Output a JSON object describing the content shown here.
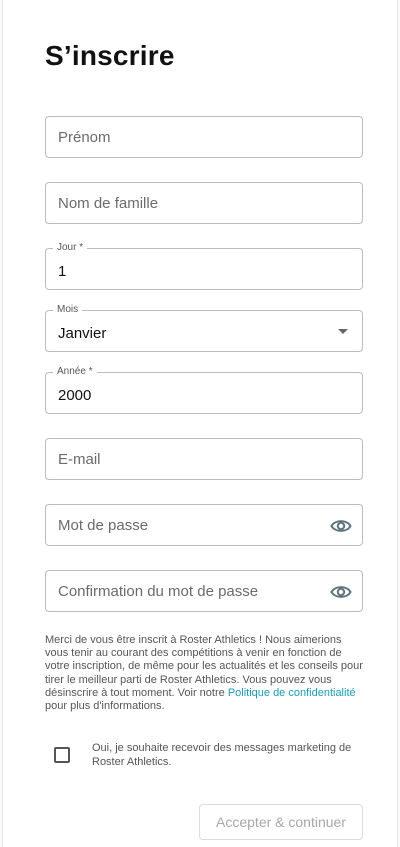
{
  "form": {
    "title": "S’inscrire",
    "first_name": {
      "placeholder": "Prénom"
    },
    "last_name": {
      "placeholder": "Nom de famille"
    },
    "day": {
      "label": "Jour *",
      "value": "1"
    },
    "month": {
      "label": "Mois",
      "value": "Janvier"
    },
    "year": {
      "label": "Année *",
      "value": "2000"
    },
    "email": {
      "placeholder": "E-mail"
    },
    "password": {
      "placeholder": "Mot de passe"
    },
    "password_confirm": {
      "placeholder": "Confirmation du mot de passe"
    },
    "notice": {
      "text": "Merci de vous être inscrit à Roster Athletics ! Nous aimerions vous tenir au courant des compétitions à venir en fonction de votre inscription, de même pour les actualités et les conseils pour tirer le meilleur parti de Roster Athletics. Vous pouvez vous désinscrire à tout moment. Voir notre ",
      "link": "Politique de confidentialité",
      "suffix": " pour plus d'informations."
    },
    "marketing_opt_in": {
      "label": "Oui, je souhaite recevoir des messages marketing de Roster Athletics.",
      "checked": false
    },
    "submit_label": "Accepter & continuer"
  },
  "icons": {
    "eye": "eye-icon",
    "dropdown": "chevron-down-icon"
  },
  "colors": {
    "link": "#1a9bb7",
    "border": "#bcbcbc",
    "disabled_text": "#a8a8a8"
  }
}
